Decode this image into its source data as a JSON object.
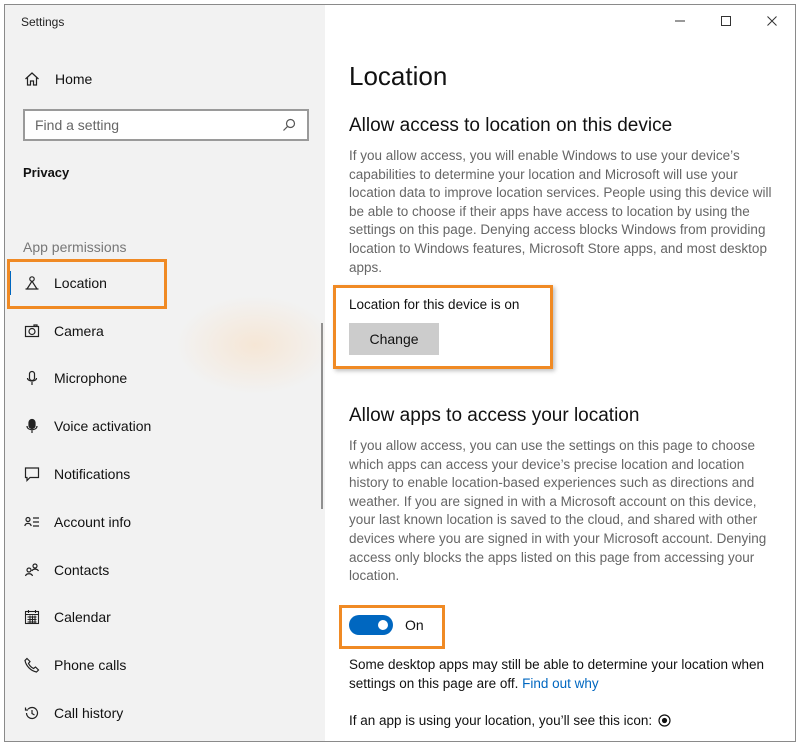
{
  "window": {
    "app_title": "Settings",
    "controls": {
      "minimize": "–",
      "maximize": "☐",
      "close": "✕"
    }
  },
  "sidebar": {
    "home_label": "Home",
    "search_placeholder": "Find a setting",
    "section_title": "Privacy",
    "group_title": "App permissions",
    "items": [
      {
        "label": "Location",
        "icon": "location-icon",
        "active": true
      },
      {
        "label": "Camera",
        "icon": "camera-icon"
      },
      {
        "label": "Microphone",
        "icon": "microphone-icon"
      },
      {
        "label": "Voice activation",
        "icon": "voice-activation-icon"
      },
      {
        "label": "Notifications",
        "icon": "notifications-icon"
      },
      {
        "label": "Account info",
        "icon": "account-info-icon"
      },
      {
        "label": "Contacts",
        "icon": "contacts-icon"
      },
      {
        "label": "Calendar",
        "icon": "calendar-icon"
      },
      {
        "label": "Phone calls",
        "icon": "phone-calls-icon"
      },
      {
        "label": "Call history",
        "icon": "call-history-icon"
      }
    ]
  },
  "content": {
    "page_title": "Location",
    "device_section": {
      "heading": "Allow access to location on this device",
      "description": "If you allow access, you will enable Windows to use your device’s capabilities to determine your location and Microsoft will use your location data to improve location services. People using this device will be able to choose if their apps have access to location by using the settings on this page. Denying access blocks Windows from providing location to Windows features, Microsoft Store apps, and most desktop apps.",
      "status": "Location for this device is on",
      "change_label": "Change"
    },
    "apps_section": {
      "heading": "Allow apps to access your location",
      "description": "If you allow access, you can use the settings on this page to choose which apps can access your device’s precise location and location history to enable location-based experiences such as directions and weather. If you are signed in with a Microsoft account on this device, your last known location is saved to the cloud, and shared with other devices where you are signed in with your Microsoft account. Denying access only blocks the apps listed on this page from accessing your location.",
      "toggle_state": "On",
      "toggle_on": true,
      "note_text": "Some desktop apps may still be able to determine your location when settings on this page are off.",
      "note_link": "Find out why",
      "icon_note": "If an app is using your location, you’ll see this icon:"
    }
  },
  "colors": {
    "accent": "#0067c0",
    "highlight": "#f08a24",
    "sidebar_bg": "#f2f2f2"
  }
}
